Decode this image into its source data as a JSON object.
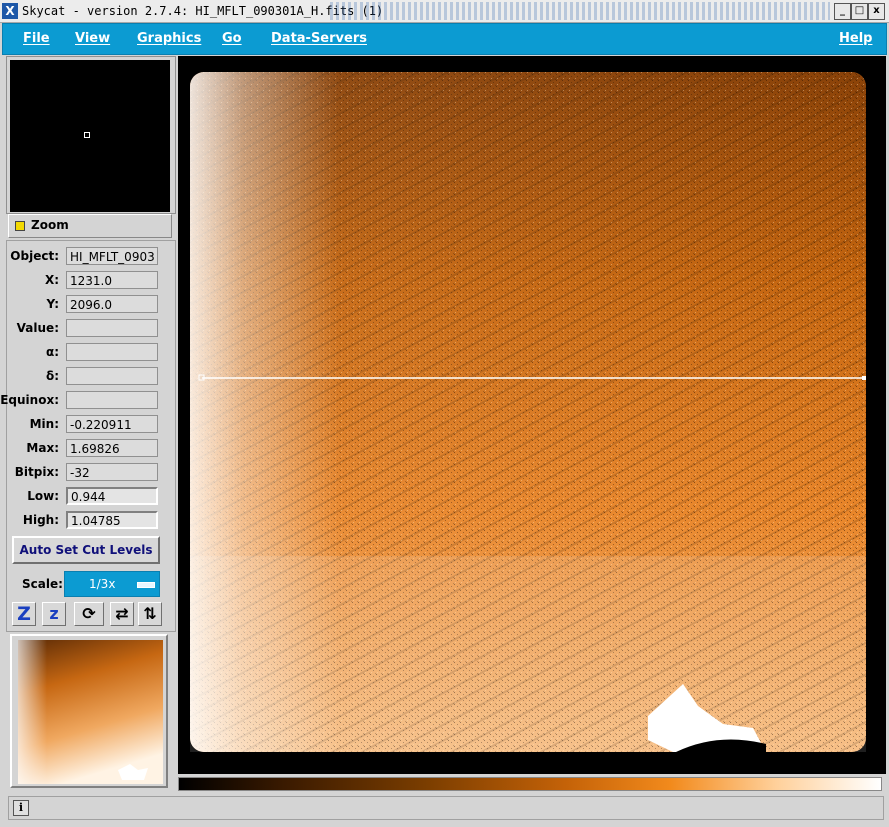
{
  "window": {
    "title": "Skycat - version 2.7.4: HI_MFLT_090301A_H.fits (1)",
    "controls": [
      "_",
      "□",
      "x"
    ]
  },
  "menubar": {
    "items": [
      "File",
      "View",
      "Graphics",
      "Go",
      "Data-Servers"
    ],
    "help": "Help"
  },
  "zoom": {
    "label": "Zoom"
  },
  "info": {
    "fields": [
      {
        "label": "Object:",
        "value": "HI_MFLT_0903",
        "kind": "readonly"
      },
      {
        "label": "X:",
        "value": "1231.0",
        "kind": "readonly"
      },
      {
        "label": "Y:",
        "value": "2096.0",
        "kind": "readonly"
      },
      {
        "label": "Value:",
        "value": "",
        "kind": "readonly"
      },
      {
        "label": "α:",
        "value": "",
        "kind": "readonly"
      },
      {
        "label": "δ:",
        "value": "",
        "kind": "readonly"
      },
      {
        "label": "Equinox:",
        "value": "",
        "kind": "readonly"
      },
      {
        "label": "Min:",
        "value": "-0.220911",
        "kind": "readonly"
      },
      {
        "label": "Max:",
        "value": "1.69826",
        "kind": "readonly"
      },
      {
        "label": "Bitpix:",
        "value": "-32",
        "kind": "readonly"
      },
      {
        "label": "Low:",
        "value": "0.944",
        "kind": "entry"
      },
      {
        "label": "High:",
        "value": "1.04785",
        "kind": "entry"
      }
    ]
  },
  "cut_levels": {
    "button": "Auto Set Cut Levels"
  },
  "scale": {
    "label": "Scale:",
    "value": "1/3x"
  },
  "tools": {
    "zoom_in": "Z",
    "zoom_out": "z",
    "rotate": "⟳",
    "flip_x": "⇄",
    "flip_y": "⇅"
  },
  "colors": {
    "menu_bg": "#0c9bd2",
    "image_orange": "#e07a1c",
    "image_dark": "#3a1c04"
  }
}
